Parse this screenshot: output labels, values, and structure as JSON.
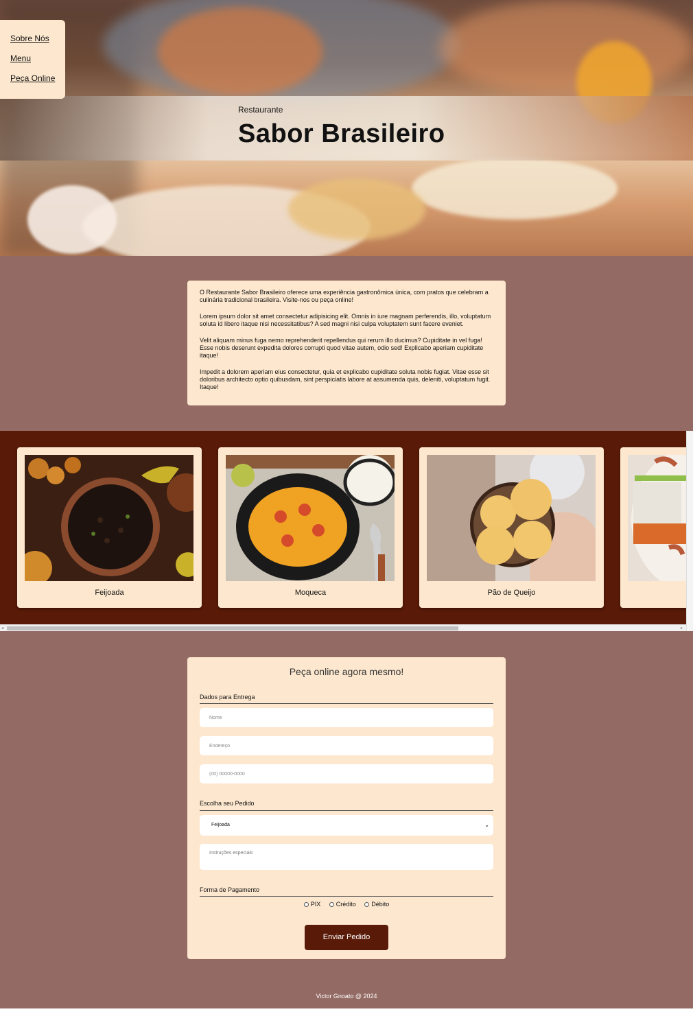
{
  "nav": {
    "items": [
      "Sobre Nós",
      "Menu",
      "Peça Online"
    ]
  },
  "hero": {
    "subtitle": "Restaurante",
    "title": "Sabor Brasileiro"
  },
  "about": {
    "paragraphs": [
      "O Restaurante Sabor Brasileiro oferece uma experiência gastronômica única, com pratos que celebram a culinária tradicional brasileira. Visite-nos ou peça online!",
      "Lorem ipsum dolor sit amet consectetur adipisicing elit. Omnis in iure magnam perferendis, illo, voluptatum soluta id libero itaque nisi necessitatibus? A sed magni nisi culpa voluptatem sunt facere eveniet.",
      "Velit aliquam minus fuga nemo reprehenderit repellendus qui rerum illo ducimus? Cupiditate in vel fuga! Esse nobis deserunt expedita dolores corrupti quod vitae autem, odio sed! Explicabo aperiam cupiditate itaque!",
      "Impedit a dolorem aperiam eius consectetur, quia et explicabo cupiditate soluta nobis fugiat. Vitae esse sit doloribus architecto optio quibusdam, sint perspiciatis labore at assumenda quis, deleniti, voluptatum fugit. Itaque!"
    ]
  },
  "menu": {
    "dishes": [
      {
        "name": "Feijoada"
      },
      {
        "name": "Moqueca"
      },
      {
        "name": "Pão de Queijo"
      },
      {
        "name": ""
      }
    ]
  },
  "order": {
    "title": "Peça online agora mesmo!",
    "delivery_legend": "Dados para Entrega",
    "name_placeholder": "Nome",
    "address_placeholder": "Endereço",
    "phone_placeholder": "(00) 00000-0000",
    "order_legend": "Escolha seu Pedido",
    "selected_dish": "Feijoada",
    "instructions_placeholder": "Instruções especiais",
    "payment_legend": "Forma de Pagamento",
    "payment_options": [
      "PIX",
      "Crédito",
      "Débito"
    ],
    "submit_label": "Enviar Pedido"
  },
  "footer": {
    "text": "Victor Gnoato @ 2024"
  }
}
